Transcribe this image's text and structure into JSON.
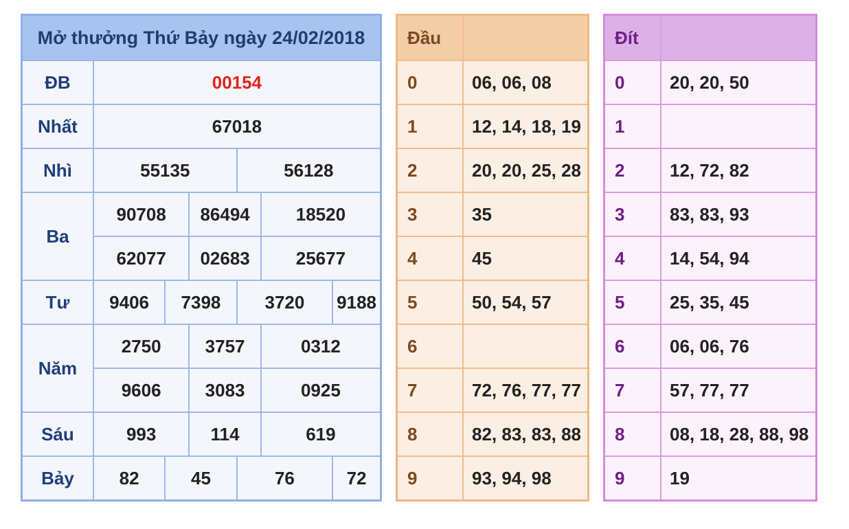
{
  "results": {
    "title": "Mở thưởng Thứ Bảy ngày 24/02/2018",
    "labels": {
      "db": "ĐB",
      "nhat": "Nhất",
      "nhi": "Nhì",
      "ba": "Ba",
      "tu": "Tư",
      "nam": "Năm",
      "sau": "Sáu",
      "bay": "Bảy"
    },
    "db": "00154",
    "nhat": "67018",
    "nhi": [
      "55135",
      "56128"
    ],
    "ba": [
      [
        "90708",
        "86494",
        "18520"
      ],
      [
        "62077",
        "02683",
        "25677"
      ]
    ],
    "tu": [
      "9406",
      "7398",
      "3720",
      "9188"
    ],
    "nam": [
      [
        "2750",
        "3757",
        "0312"
      ],
      [
        "9606",
        "3083",
        "0925"
      ]
    ],
    "sau": [
      "993",
      "114",
      "619"
    ],
    "bay": [
      "82",
      "45",
      "76",
      "72"
    ]
  },
  "dau": {
    "header": "Đầu",
    "rows": [
      {
        "digit": "0",
        "values": "06, 06, 08"
      },
      {
        "digit": "1",
        "values": "12, 14, 18, 19"
      },
      {
        "digit": "2",
        "values": "20, 20, 25, 28"
      },
      {
        "digit": "3",
        "values": "35"
      },
      {
        "digit": "4",
        "values": "45"
      },
      {
        "digit": "5",
        "values": "50, 54, 57"
      },
      {
        "digit": "6",
        "values": ""
      },
      {
        "digit": "7",
        "values": "72, 76, 77, 77"
      },
      {
        "digit": "8",
        "values": "82, 83, 83, 88"
      },
      {
        "digit": "9",
        "values": "93, 94, 98"
      }
    ]
  },
  "dit": {
    "header": "Đít",
    "rows": [
      {
        "digit": "0",
        "values": "20, 20, 50"
      },
      {
        "digit": "1",
        "values": ""
      },
      {
        "digit": "2",
        "values": "12, 72, 82"
      },
      {
        "digit": "3",
        "values": "83, 83, 93"
      },
      {
        "digit": "4",
        "values": "14, 54, 94"
      },
      {
        "digit": "5",
        "values": "25, 35, 45"
      },
      {
        "digit": "6",
        "values": "06, 06, 76"
      },
      {
        "digit": "7",
        "values": "57, 77, 77"
      },
      {
        "digit": "8",
        "values": "08, 18, 28, 88, 98"
      },
      {
        "digit": "9",
        "values": "19"
      }
    ]
  },
  "colors": {
    "special_prize": "#e2231a",
    "results_header": "#a9c3f0",
    "dau_header": "#f3cda7",
    "dit_header": "#dcb2e6"
  }
}
